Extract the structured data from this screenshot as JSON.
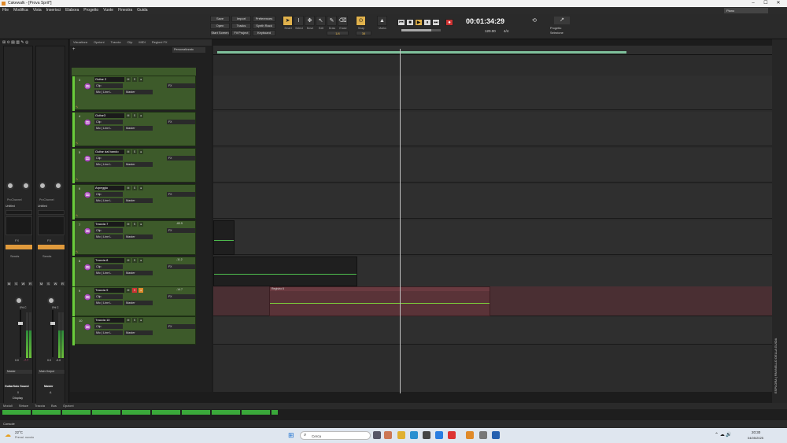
{
  "window": {
    "title": "Cakewalk - [Prova Sprit*]",
    "controls": [
      "–",
      "☐",
      "✕"
    ]
  },
  "menu": [
    "File",
    "Modifica",
    "Vista",
    "Inserisci",
    "Elabora",
    "Progetto",
    "Vuote",
    "Finestra",
    "Guida"
  ],
  "controlbar": {
    "left_buttons": [
      [
        "Save",
        "Import",
        "Preferences"
      ],
      [
        "Open",
        "Tracks",
        "Synth Rack"
      ],
      [
        "Start Screen",
        "Fit Project",
        "Keyboard"
      ]
    ],
    "tools": [
      "Smart",
      "Select",
      "Move",
      "Edit",
      "Draw",
      "Erase"
    ],
    "snap_label": "Snap",
    "snap_value": "1/4",
    "marks_label": "Marks",
    "marks_value": "38",
    "time": "00:01:34:29",
    "tempo": "120.00",
    "meter": "4/4",
    "project_label": "Progetto",
    "selection_label": "Selezione",
    "preset": "Piano"
  },
  "inspector": {
    "strip1": {
      "name": "GuitarSolo Sound",
      "fx": "ProChannel",
      "label_untitled": "Untitled",
      "sends": "Sends",
      "input": "FX",
      "pan": "0% C",
      "vol_l": "0.0",
      "vol_r": "-7.7",
      "io": "Master",
      "bus_num": "0"
    },
    "strip2": {
      "name": "Master",
      "fx": "ProChannel",
      "label_untitled": "Untitled",
      "sends": "Sends",
      "input": "FX",
      "pan": "0% C",
      "vol_l": "0.0",
      "vol_r": "-0.0",
      "io": "Main Output",
      "bus_num": "A"
    },
    "display_tab": "Display"
  },
  "trackview": {
    "tabs": [
      "Visualizza",
      "Opzioni",
      "Traccia",
      "Clip",
      "MIDI",
      "Regioni FX"
    ],
    "dropdown": "Personalizzato",
    "tracks": [
      {
        "num": "3",
        "name": "Guitar 2",
        "clip": "Clip",
        "input": "Mic | Line L",
        "output": "Master",
        "vol": ""
      },
      {
        "num": "4",
        "name": "Guitar3",
        "clip": "Clip",
        "input": "Mic | Line L",
        "output": "Master",
        "vol": ""
      },
      {
        "num": "5",
        "name": "Guitar dal bando",
        "clip": "Clip",
        "input": "Mic | Line L",
        "output": "Master",
        "vol": ""
      },
      {
        "num": "6",
        "name": "Arpeggio",
        "clip": "Clip",
        "input": "Mic | Line L",
        "output": "Master",
        "vol": ""
      },
      {
        "num": "7",
        "name": "Traccia 7",
        "clip": "Clip",
        "input": "Mic | Line L",
        "output": "Master",
        "vol": "-60.5"
      },
      {
        "num": "8",
        "name": "Traccia 8",
        "clip": "Clip",
        "input": "Mic | Line L",
        "output": "Master",
        "vol": "-11.2"
      },
      {
        "num": "9",
        "name": "Traccia 9",
        "clip": "Clip",
        "input": "Mic | Line L",
        "output": "Master",
        "vol": "-14.7"
      },
      {
        "num": "10",
        "name": "Traccia 10",
        "clip": "Clip",
        "input": "Mic | Line L",
        "output": "Master",
        "vol": ""
      }
    ],
    "fx_label": "FX",
    "region_clip": "Registro 6"
  },
  "right_panel": {
    "label": "ESPLORA | PANNELLO DELLA GUIDA"
  },
  "bottom_tabs": [
    "Moduli",
    "Strisce",
    "Traccia",
    "Bus",
    "Opzioni"
  ],
  "console_label": "Console",
  "taskbar": {
    "weather_temp": "22°C",
    "weather_desc": "Preval. nuvolo",
    "search": "Cerca",
    "time": "20:30",
    "date": "04/05/2025"
  }
}
